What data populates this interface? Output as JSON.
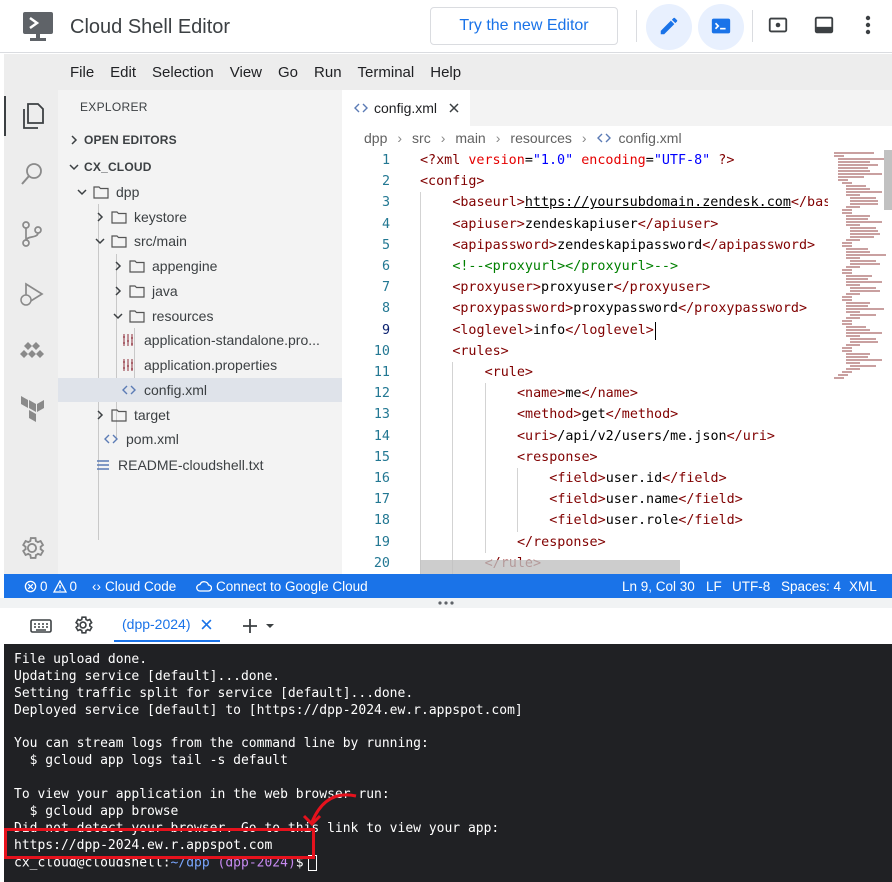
{
  "app": {
    "title": "Cloud Shell Editor",
    "try_new_editor": "Try the new Editor"
  },
  "menu": [
    "File",
    "Edit",
    "Selection",
    "View",
    "Go",
    "Run",
    "Terminal",
    "Help"
  ],
  "activity_icons": [
    "files-icon",
    "search-icon",
    "source-control-icon",
    "run-debug-icon",
    "cloud-code-icon",
    "terraform-icon",
    "settings-gear-icon"
  ],
  "explorer": {
    "title": "EXPLORER",
    "open_editors": "OPEN EDITORS",
    "workspace": "CX_CLOUD",
    "tree": [
      {
        "label": "dpp",
        "type": "folder",
        "expanded": true
      },
      {
        "label": "keystore",
        "type": "folder",
        "expanded": false
      },
      {
        "label": "src/main",
        "type": "folder",
        "expanded": true
      },
      {
        "label": "appengine",
        "type": "folder",
        "expanded": false
      },
      {
        "label": "java",
        "type": "folder",
        "expanded": false
      },
      {
        "label": "resources",
        "type": "folder",
        "expanded": true
      },
      {
        "label": "application-standalone.pro...",
        "type": "properties"
      },
      {
        "label": "application.properties",
        "type": "properties"
      },
      {
        "label": "config.xml",
        "type": "xml",
        "selected": true
      },
      {
        "label": "target",
        "type": "folder",
        "expanded": false
      },
      {
        "label": "pom.xml",
        "type": "xml"
      },
      {
        "label": "README-cloudshell.txt",
        "type": "text"
      }
    ]
  },
  "editor": {
    "tab": "config.xml",
    "breadcrumb": [
      "dpp",
      "src",
      "main",
      "resources",
      "config.xml"
    ],
    "lines": [
      {
        "n": "1",
        "indent": 0,
        "parts": [
          [
            "tg",
            "<?xml "
          ],
          [
            "at",
            "version"
          ],
          [
            "tx",
            "="
          ],
          [
            "av",
            "\"1.0\""
          ],
          [
            "tx",
            " "
          ],
          [
            "at",
            "encoding"
          ],
          [
            "tx",
            "="
          ],
          [
            "av",
            "\"UTF-8\""
          ],
          [
            "tg",
            " ?>"
          ]
        ]
      },
      {
        "n": "2",
        "indent": 0,
        "parts": [
          [
            "tg",
            "<config>"
          ]
        ]
      },
      {
        "n": "3",
        "indent": 1,
        "parts": [
          [
            "tg",
            "<baseurl>"
          ],
          [
            "tx",
            "https://yoursubdomain.zendesk.com"
          ],
          [
            "tg",
            "</baseurl>"
          ]
        ]
      },
      {
        "n": "4",
        "indent": 1,
        "parts": [
          [
            "tg",
            "<apiuser>"
          ],
          [
            "tx",
            "zendeskapiuser"
          ],
          [
            "tg",
            "</apiuser>"
          ]
        ]
      },
      {
        "n": "5",
        "indent": 1,
        "parts": [
          [
            "tg",
            "<apipassword>"
          ],
          [
            "tx",
            "zendeskapipassword"
          ],
          [
            "tg",
            "</apipassword>"
          ]
        ]
      },
      {
        "n": "6",
        "indent": 1,
        "parts": [
          [
            "cm",
            "<!--<proxyurl></proxyurl>-->"
          ]
        ]
      },
      {
        "n": "7",
        "indent": 1,
        "parts": [
          [
            "tg",
            "<proxyuser>"
          ],
          [
            "tx",
            "proxyuser"
          ],
          [
            "tg",
            "</proxyuser>"
          ]
        ]
      },
      {
        "n": "8",
        "indent": 1,
        "parts": [
          [
            "tg",
            "<proxypassword>"
          ],
          [
            "tx",
            "proxypassword"
          ],
          [
            "tg",
            "</proxypassword>"
          ]
        ]
      },
      {
        "n": "9",
        "indent": 1,
        "parts": [
          [
            "tg",
            "<loglevel>"
          ],
          [
            "tx",
            "info"
          ],
          [
            "tg",
            "</loglevel>"
          ]
        ]
      },
      {
        "n": "10",
        "indent": 1,
        "parts": [
          [
            "tg",
            "<rules>"
          ]
        ]
      },
      {
        "n": "11",
        "indent": 2,
        "parts": [
          [
            "tg",
            "<rule>"
          ]
        ]
      },
      {
        "n": "12",
        "indent": 3,
        "parts": [
          [
            "tg",
            "<name>"
          ],
          [
            "tx",
            "me"
          ],
          [
            "tg",
            "</name>"
          ]
        ]
      },
      {
        "n": "13",
        "indent": 3,
        "parts": [
          [
            "tg",
            "<method>"
          ],
          [
            "tx",
            "get"
          ],
          [
            "tg",
            "</method>"
          ]
        ]
      },
      {
        "n": "14",
        "indent": 3,
        "parts": [
          [
            "tg",
            "<uri>"
          ],
          [
            "tx",
            "/api/v2/users/me.json"
          ],
          [
            "tg",
            "</uri>"
          ]
        ]
      },
      {
        "n": "15",
        "indent": 3,
        "parts": [
          [
            "tg",
            "<response>"
          ]
        ]
      },
      {
        "n": "16",
        "indent": 4,
        "parts": [
          [
            "tg",
            "<field>"
          ],
          [
            "tx",
            "user.id"
          ],
          [
            "tg",
            "</field>"
          ]
        ]
      },
      {
        "n": "17",
        "indent": 4,
        "parts": [
          [
            "tg",
            "<field>"
          ],
          [
            "tx",
            "user.name"
          ],
          [
            "tg",
            "</field>"
          ]
        ]
      },
      {
        "n": "18",
        "indent": 4,
        "parts": [
          [
            "tg",
            "<field>"
          ],
          [
            "tx",
            "user.role"
          ],
          [
            "tg",
            "</field>"
          ]
        ]
      },
      {
        "n": "19",
        "indent": 3,
        "parts": [
          [
            "tg",
            "</response>"
          ]
        ]
      },
      {
        "n": "20",
        "indent": 2,
        "parts": [
          [
            "tg",
            "</rule>"
          ]
        ]
      }
    ]
  },
  "status": {
    "errors": "0",
    "warnings": "0",
    "cloud_code": "Cloud Code",
    "connect": "Connect to Google Cloud",
    "position": "Ln 9, Col 30",
    "eol": "LF",
    "encoding": "UTF-8",
    "spaces": "Spaces: 4",
    "language": "XML"
  },
  "terminal": {
    "tab": "(dpp-2024)",
    "lines": [
      "File upload done.",
      "Updating service [default]...done.",
      "Setting traffic split for service [default]...done.",
      "Deployed service [default] to [https://dpp-2024.ew.r.appspot.com]",
      "",
      "You can stream logs from the command line by running:",
      "  $ gcloud app logs tail -s default",
      "",
      "To view your application in the web browser run:",
      "  $ gcloud app browse",
      "Did not detect your browser. Go to this link to view your app:",
      "https://dpp-2024.ew.r.appspot.com"
    ],
    "prompt_user": "cx_cloud@cloudshell:",
    "prompt_path": "~/dpp",
    "prompt_project": "(dpp-2024)",
    "prompt_symbol": "$"
  }
}
